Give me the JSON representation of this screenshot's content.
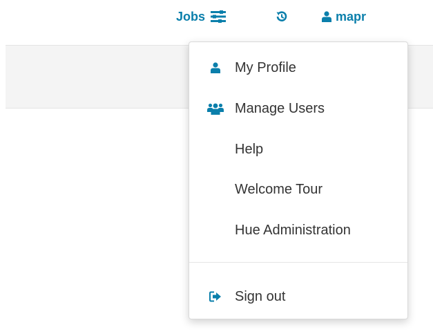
{
  "topnav": {
    "jobs_label": "Jobs",
    "jobs_icon": "jobs-list-icon",
    "history_icon": "history-icon",
    "user_icon": "user-icon",
    "user_label": "mapr"
  },
  "dropdown": {
    "items": [
      {
        "label": "My Profile",
        "icon": "user-icon"
      },
      {
        "label": "Manage Users",
        "icon": "users-icon"
      },
      {
        "label": "Help",
        "icon": ""
      },
      {
        "label": "Welcome Tour",
        "icon": ""
      },
      {
        "label": "Hue Administration",
        "icon": ""
      }
    ],
    "sign_out": {
      "label": "Sign out",
      "icon": "sign-out-icon"
    }
  },
  "colors": {
    "accent": "#0b7fab",
    "menu_text": "#333333",
    "subbar_bg": "#f4f4f4"
  }
}
